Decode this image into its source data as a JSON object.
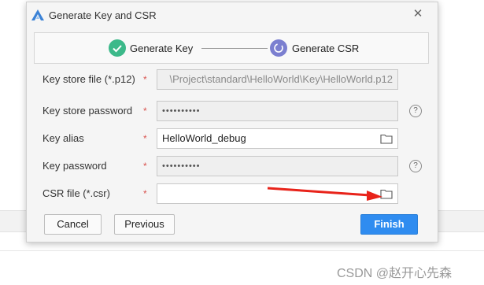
{
  "window": {
    "title": "Generate Key and CSR"
  },
  "steps": [
    {
      "label": "Generate Key",
      "status": "done",
      "color": "#3cb98a"
    },
    {
      "label": "Generate CSR",
      "status": "active",
      "color": "#7b7fd0"
    }
  ],
  "form": {
    "required_mark": "*",
    "keystore_file": {
      "label": "Key store file (*.p12)",
      "value": "\\Project\\standard\\HelloWorld\\Key\\HelloWorld.p12"
    },
    "keystore_password": {
      "label": "Key store password",
      "value": "••••••••••"
    },
    "key_alias": {
      "label": "Key alias",
      "value": "HelloWorld_debug"
    },
    "key_password": {
      "label": "Key password",
      "value": "••••••••••"
    },
    "csr_file": {
      "label": "CSR file (*.csr)",
      "value": ""
    },
    "help_glyph": "?"
  },
  "buttons": {
    "cancel": "Cancel",
    "previous": "Previous",
    "finish": "Finish"
  },
  "annotation": {
    "arrow_color": "#e8231a"
  },
  "watermark": "CSDN @赵开心先森"
}
